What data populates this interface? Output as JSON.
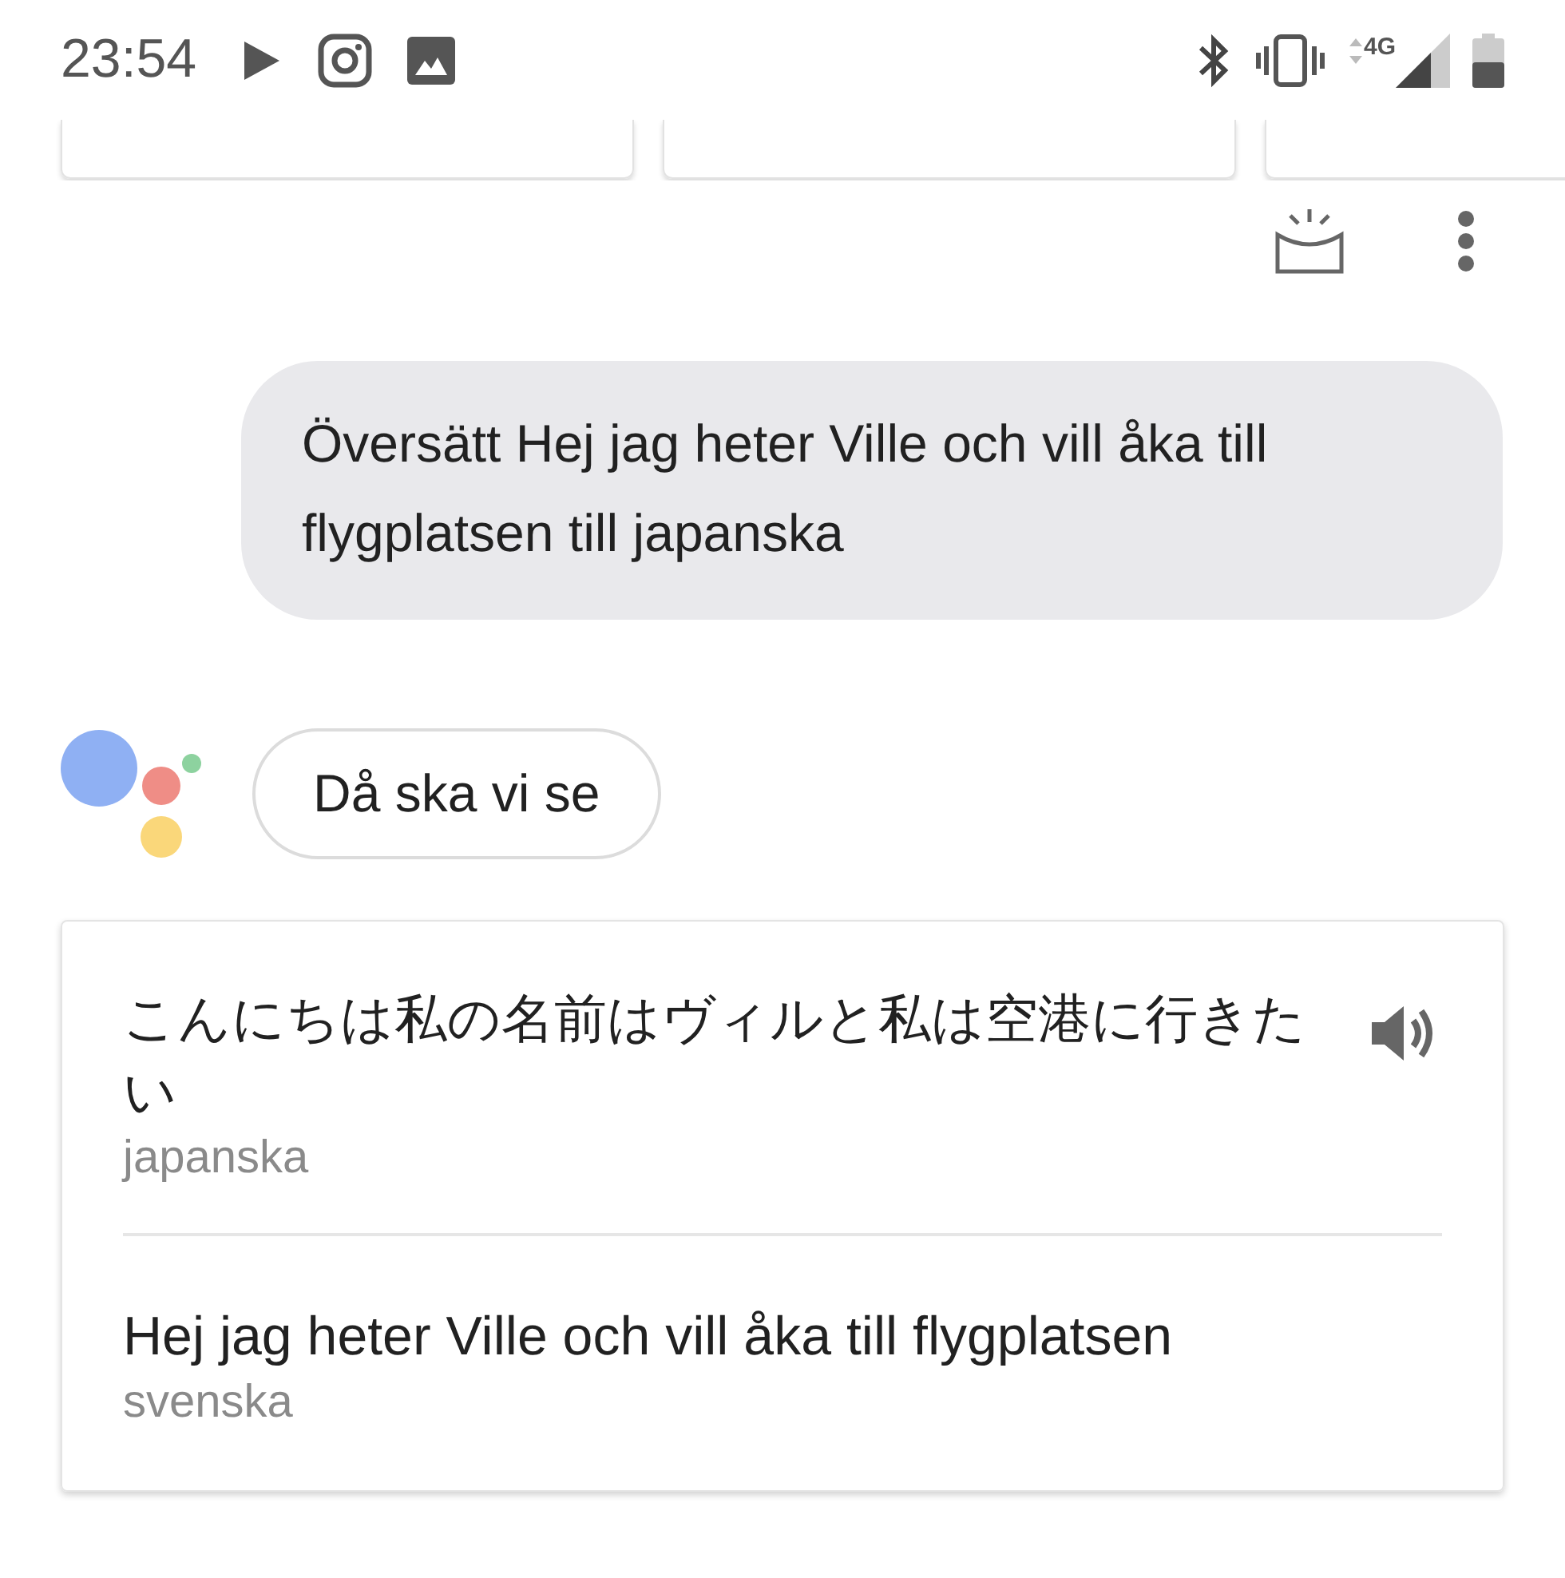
{
  "status_bar": {
    "time": "23:54",
    "network": "4G"
  },
  "user_message": "Översätt Hej jag heter Ville och vill åka till flygplatsen till japanska",
  "assistant_message": "Då ska vi se",
  "translation": {
    "translated_text": "こんにちは私の名前はヴィルと私は空港に行きたい",
    "translated_language": "japanska",
    "source_text": "Hej jag heter Ville och vill åka till flygplatsen",
    "source_language": "svenska"
  }
}
